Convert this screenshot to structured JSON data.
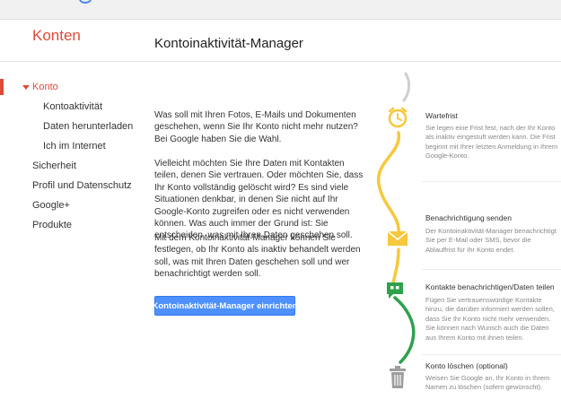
{
  "app": {
    "name": "Konten"
  },
  "page": {
    "title": "Kontoinaktivität-Manager"
  },
  "nav": {
    "konto": "Konto",
    "sub": [
      "Kontoaktivität",
      "Daten herunterladen",
      "Ich im Internet"
    ],
    "sicherheit": "Sicherheit",
    "profil": "Profil und Datenschutz",
    "googleplus": "Google+",
    "produkte": "Produkte"
  },
  "intro": {
    "p1": "Was soll mit Ihren Fotos, E-Mails und Dokumenten geschehen, wenn Sie Ihr Konto nicht mehr nutzen? Bei Google haben Sie die Wahl.",
    "p2": "Vielleicht möchten Sie Ihre Daten mit Kontakten teilen, denen Sie vertrauen. Oder möchten Sie, dass Ihr Konto vollständig gelöscht wird? Es sind viele Situationen denkbar, in denen Sie nicht auf Ihr Google-Konto zugreifen oder es nicht verwenden können. Was auch immer der Grund ist: Sie entscheiden, was mit Ihren Daten geschehen soll.",
    "p3": "Mit dem Kontoinaktivität-Manager können Sie festlegen, ob Ihr Konto als inaktiv behandelt werden soll, was mit Ihren Daten geschehen soll und wer benachrichtigt werden soll."
  },
  "cta": {
    "label": "Kontoinaktivität-Manager einrichten"
  },
  "steps": [
    {
      "icon": "alarm-clock-icon",
      "title": "Wartefrist",
      "desc": "Sie legen eine Frist fest, nach der Ihr Konto als inaktiv eingestuft werden kann. Die Frist beginnt mit Ihrer letzten Anmeldung in Ihrem Google-Konto."
    },
    {
      "icon": "envelope-icon",
      "title": "Benachrichtigung senden",
      "desc": "Der Kontoinaktivität-Manager benachrichtigt Sie per E-Mail oder SMS, bevor die Ablauffrist für Ihr Konto endet."
    },
    {
      "icon": "quote-bubble-icon",
      "title": "Kontakte benachrichtigen/Daten teilen",
      "desc": "Fügen Sie vertrauenswürdige Kontakte hinzu, die darüber informiert werden sollen, dass Sie Ihr Konto nicht mehr verwenden. Sie können nach Wunsch auch die Daten aus Ihrem Konto mit ihnen teilen."
    },
    {
      "icon": "trash-can-icon",
      "title": "Konto löschen (optional)",
      "desc": "Weisen Sie Google an, Ihr Konto in Ihrem Namen zu löschen (sofern gewünscht)."
    }
  ],
  "colors": {
    "brand": "#dd4b39",
    "button": "#4d90fe",
    "yellow": "#f6c83b",
    "green": "#2ea14d",
    "grey": "#9e9e9e"
  }
}
